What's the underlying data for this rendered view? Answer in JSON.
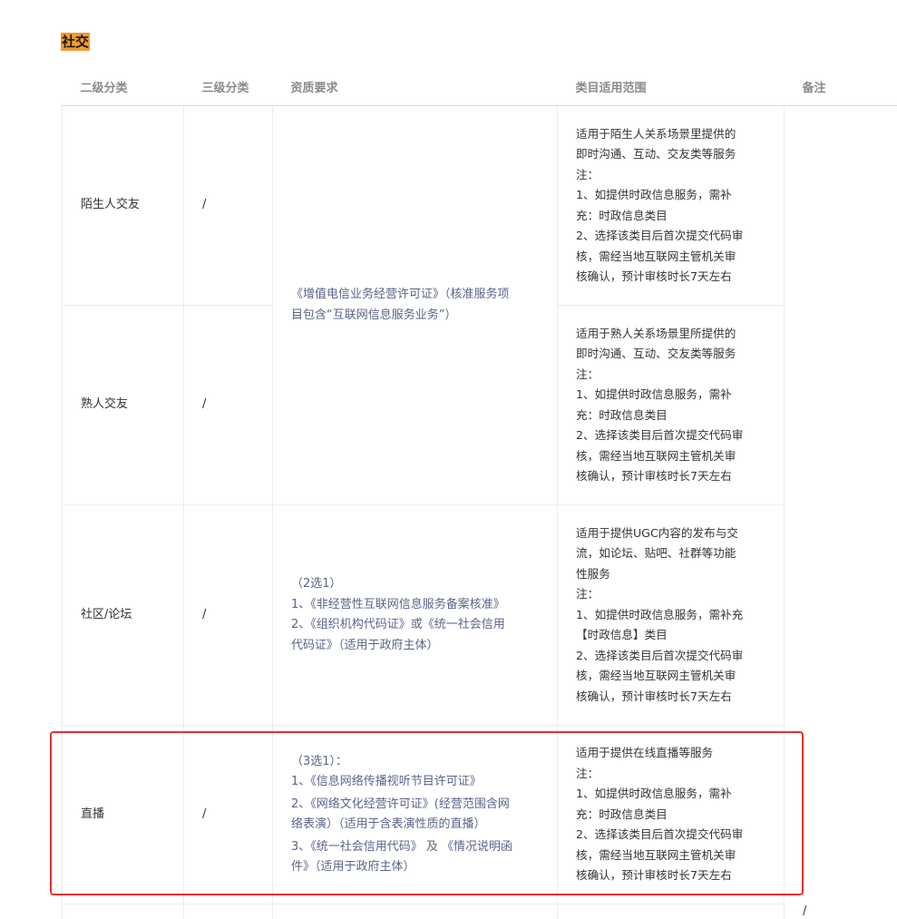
{
  "section_title": "社交",
  "headers": [
    "二级分类",
    "三级分类",
    "资质要求",
    "类目适用范围",
    "备注"
  ],
  "rows": [
    {
      "name": "陌生人交友",
      "sub": "/",
      "scope": [
        "适用于陌生人关系场景里提供的",
        "即时沟通、互动、交友类等服务",
        "注：",
        "1、如提供时政信息服务，需补",
        "充：时政信息类目",
        "2、选择该类目后首次提交代码审",
        "核，需经当地互联网主管机关审",
        "核确认，预计审核时长7天左右"
      ]
    },
    {
      "name": "熟人交友",
      "sub": "/",
      "scope": [
        "适用于熟人关系场景里所提供的",
        "即时沟通、互动、交友类等服务",
        "注：",
        "1、如提供时政信息服务，需补",
        "充：时政信息类目",
        "2、选择该类目后首次提交代码审",
        "核，需经当地互联网主管机关审",
        "核确认，预计审核时长7天左右"
      ]
    },
    {
      "name": "社区/论坛",
      "sub": "/",
      "requirement": [
        "（2选1）",
        "1、《非经营性互联网信息服务备案核准》",
        "2、《组织机构代码证》或《统一社会信用",
        "代码证》（适用于政府主体）"
      ],
      "scope": [
        "适用于提供UGC内容的发布与交",
        "流，如论坛、贴吧、社群等功能",
        "性服务",
        "注：",
        "1、如提供时政信息服务，需补充",
        "【时政信息】类目",
        "2、选择该类目后首次提交代码审",
        "核，需经当地互联网主管机关审",
        "核确认，预计审核时长7天左右"
      ]
    },
    {
      "name": "直播",
      "sub": "/",
      "requirement_paras": [
        [
          "（3选1）：",
          "1、《信息网络传播视听节目许可证》"
        ],
        [
          "2、《网络文化经营许可证》(经营范围含网",
          "络表演）（适用于含表演性质的直播）"
        ],
        [
          "3、《统一社会信用代码》 及 《情况说明函",
          "件》（适用于政府主体）"
        ]
      ],
      "scope": [
        "适用于提供在线直播等服务",
        "注：",
        "1、如提供时政信息服务，需补",
        "充：时政信息类目",
        "2、选择该类目后首次提交代码审",
        "核，需经当地互联网主管机关审",
        "核确认，预计审核时长7天左右"
      ]
    }
  ],
  "shared_requirement": [
    "《增值电信业务经营许可证》（核准服务项",
    "目包含“互联网信息服务业务”）"
  ],
  "stray_mark": "/",
  "colors": {
    "tag_bg": "#f29a2e",
    "link_text": "#596488",
    "highlight_border": "#e8302a"
  }
}
